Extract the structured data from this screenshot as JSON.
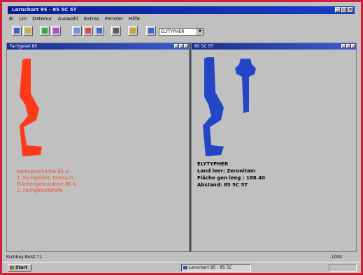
{
  "window": {
    "title": "Lernchart 95 - 85 5C 5T",
    "controls": [
      "_",
      "□",
      "×"
    ]
  },
  "menu": [
    "Ei",
    "Lm",
    "Datenur",
    "Auswahl",
    "Extras",
    "Fenster",
    "Hilfe"
  ],
  "toolbar": {
    "buttons": [
      {
        "icon": "new-icon",
        "color": "#3a62c9"
      },
      {
        "icon": "open-icon",
        "color": "#c9b23a"
      },
      {
        "icon": "green-icon",
        "color": "#3aa84a"
      },
      {
        "icon": "print-icon",
        "color": "#b84ac9"
      },
      {
        "icon": "cut-icon",
        "color": "#7a8fd0"
      },
      {
        "icon": "copy-icon",
        "color": "#d05050"
      },
      {
        "icon": "paste-icon",
        "color": "#4a6ad0"
      },
      {
        "icon": "tool-icon",
        "color": "#5a5a5a"
      },
      {
        "icon": "chart-icon",
        "color": "#d0a030"
      },
      {
        "icon": "back-icon",
        "color": "#3a62c9"
      }
    ],
    "combo_value": "ELYTYPHER"
  },
  "left_pane": {
    "title": "Fachgesel 85",
    "shape_color": "#ff3a1a",
    "lines": [
      "Fachsprachliche 85 A",
      "1. Fachgebiet: Deutsch",
      "Flächengebundene 85 A",
      "2. Fachgebietshilfe"
    ]
  },
  "right_pane": {
    "title": "85 5C 5T",
    "shape_color": "#2346c6",
    "lines": [
      "ELYTYPHER",
      "Land leer: Zeronitam",
      "Fläche gen leeg : 188.40",
      "Abstand: 85 5C 5T"
    ]
  },
  "status": {
    "left": "Fachbey Belst 71",
    "right": "1000"
  },
  "taskbar": {
    "start_label": "Start",
    "task_label": "Lernchart 95 - 85 5C",
    "clock": ""
  }
}
